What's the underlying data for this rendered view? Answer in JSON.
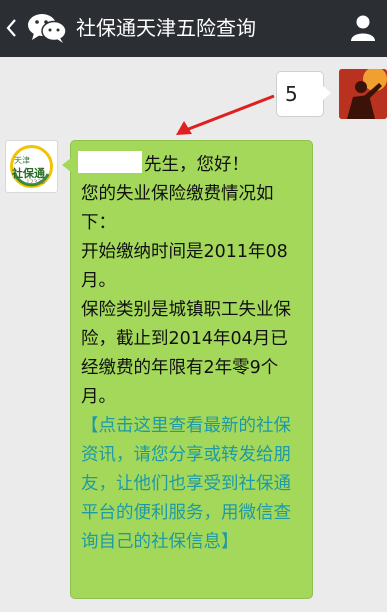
{
  "header": {
    "back_glyph": "‹",
    "title": "社保通天津五险查询",
    "icons": [
      "back-icon",
      "wechat-icon",
      "profile-icon"
    ]
  },
  "sent_message": {
    "text": "5"
  },
  "bot_avatar": {
    "line1": "天津",
    "line2": "社保通",
    "line3": "12333"
  },
  "reply": {
    "greeting_suffix": "先生，您好！",
    "p1": "您的失业保险缴费情况如下：",
    "p2": "开始缴纳时间是2011年08月。",
    "p3": "保险类别是城镇职工失业保险，截止到2014年04月已经缴费的年限有2年零9个月。",
    "link": "【点击这里查看最新的社保资讯，请您分享或转发给朋友，让他们也享受到社保通平台的便利服务，用微信查询自己的社保信息】"
  },
  "colors": {
    "titlebar": "#2b2e33",
    "background": "#ebebeb",
    "bubble_green": "#a3d85a",
    "link": "#1e9aa6",
    "arrow": "#e02020"
  }
}
